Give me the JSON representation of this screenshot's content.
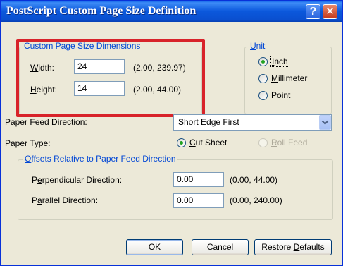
{
  "window": {
    "title": "PostScript Custom Page Size Definition",
    "help_label": "?",
    "close_label": "✕"
  },
  "dimensions": {
    "legend": "Custom Page Size Dimensions",
    "width": {
      "label_key": "W",
      "label_rest": "idth:",
      "value": "24",
      "range": "(2.00, 239.97)"
    },
    "height": {
      "label_key": "H",
      "label_rest": "eight:",
      "value": "14",
      "range": "(2.00, 44.00)"
    }
  },
  "unit": {
    "legend_key": "U",
    "legend_rest": "nit",
    "options": [
      {
        "key": "I",
        "rest": "nch",
        "selected": true
      },
      {
        "key": "M",
        "rest": "illimeter",
        "selected": false
      },
      {
        "key": "P",
        "rest": "oint",
        "selected": false
      }
    ]
  },
  "paper_feed": {
    "label_pre": "Paper ",
    "label_key": "F",
    "label_rest": "eed Direction:",
    "selected": "Short Edge First"
  },
  "paper_type": {
    "label_pre": "Paper ",
    "label_key": "T",
    "label_rest": "ype:",
    "cut_sheet": {
      "key": "C",
      "rest": "ut Sheet",
      "selected": true
    },
    "roll_feed": {
      "key": "R",
      "rest": "oll Feed",
      "enabled": false
    }
  },
  "offsets": {
    "legend_key": "O",
    "legend_rest": "ffsets Relative to Paper Feed Direction",
    "perpendicular": {
      "label_pre": "P",
      "label_key": "e",
      "label_rest": "rpendicular Direction:",
      "value": "0.00",
      "range": "(0.00, 44.00)"
    },
    "parallel": {
      "label_pre": "P",
      "label_key": "a",
      "label_rest": "rallel Direction:",
      "value": "0.00",
      "range": "(0.00, 240.00)"
    }
  },
  "buttons": {
    "ok": "OK",
    "cancel": "Cancel",
    "restore_pre": "Restore ",
    "restore_key": "D",
    "restore_rest": "efaults"
  },
  "colors": {
    "highlight": "#d8232a",
    "titlebar": "#0a5fe6",
    "legend_text": "#0046d5"
  }
}
